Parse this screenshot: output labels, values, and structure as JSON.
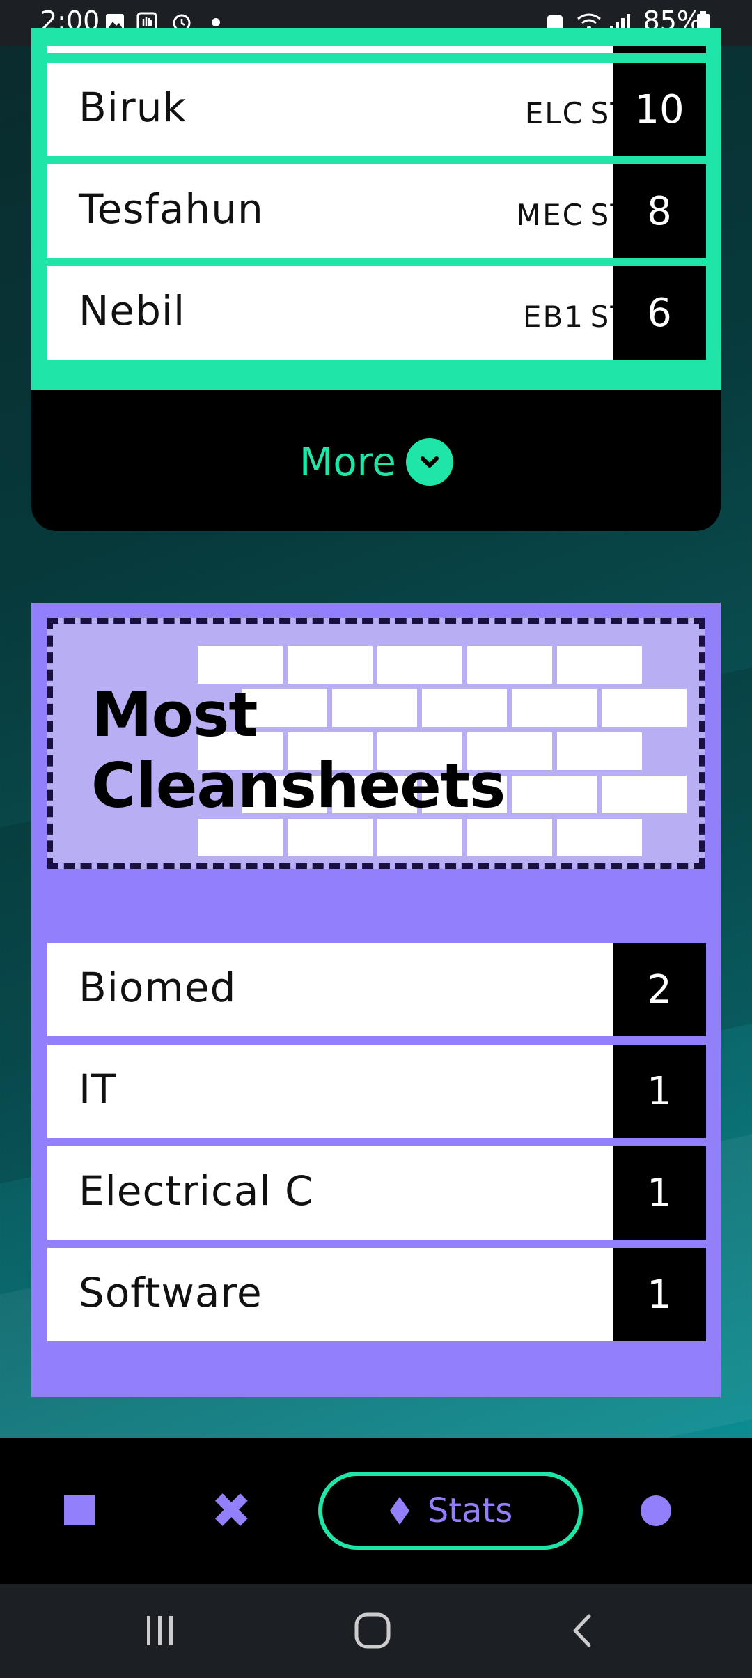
{
  "status_bar": {
    "time": "2:00",
    "battery": "85%"
  },
  "top_scorers": {
    "rows": [
      {
        "name": "Biruk",
        "team": "ELC",
        "position": "ST",
        "goals": "10"
      },
      {
        "name": "Tesfahun",
        "team": "MEC",
        "position": "ST",
        "goals": "8"
      },
      {
        "name": "Nebil",
        "team": "EB1",
        "position": "ST",
        "goals": "6"
      }
    ],
    "more_label": "More"
  },
  "cleansheets": {
    "title_line1": "Most",
    "title_line2": "Cleansheets",
    "rows": [
      {
        "name": "Biomed",
        "value": "2"
      },
      {
        "name": "IT",
        "value": "1"
      },
      {
        "name": "Electrical C",
        "value": "1"
      },
      {
        "name": "Software",
        "value": "1"
      }
    ]
  },
  "bottom_nav": {
    "stats_label": "Stats",
    "items": [
      "square-icon",
      "x-icon",
      "diamond-icon",
      "circle-icon"
    ]
  },
  "colors": {
    "accent_green": "#1fe5a8",
    "accent_purple": "#9280fa",
    "header_bg": "#b8aef3"
  }
}
